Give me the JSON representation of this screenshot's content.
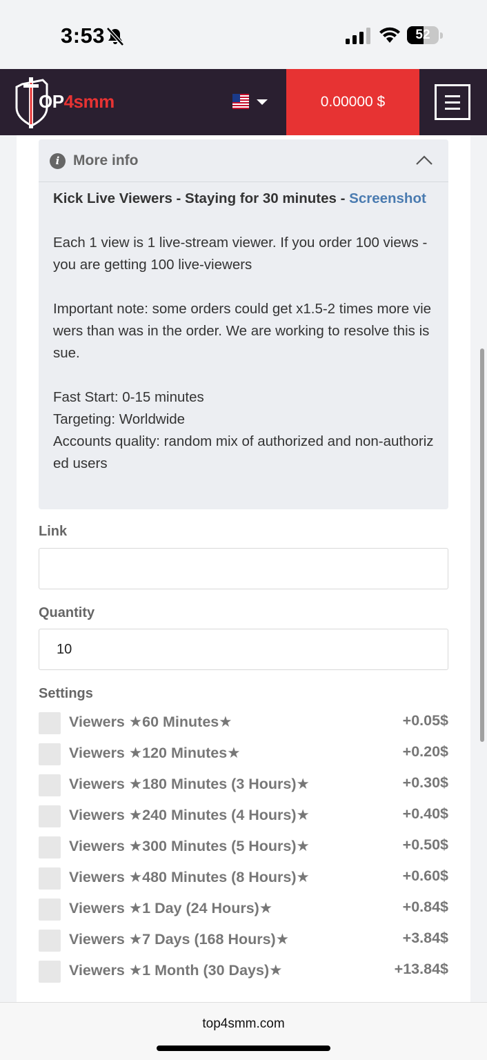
{
  "status_bar": {
    "time": "3:53",
    "battery_level": "52",
    "icons": [
      "bell-muted-icon",
      "cellular-signal-icon",
      "wifi-icon",
      "battery-icon"
    ]
  },
  "header": {
    "logo_prefix": "OP",
    "logo_accent": "4smm",
    "language_flag": "us-flag-icon",
    "balance": "0.00000 $",
    "menu_icon": "hamburger-menu-icon",
    "colors": {
      "background": "#2a1f30",
      "balance_bg": "#e73333"
    }
  },
  "more_info": {
    "title": "More info",
    "service_name": "Kick Live Viewers - Staying for 30 minutes - ",
    "screenshot_link": "Screenshot",
    "paragraph_1": "Each 1 view is 1 live-stream viewer. If you order 100 views - you are getting 100 live-viewers",
    "paragraph_2": "Important note: some orders could get x1.5-2 times more viewers than was in the order. We are working to resolve this issue.",
    "fast_start": "Fast Start: 0-15 minutes",
    "targeting": "Targeting: Worldwide",
    "accounts_quality": "Accounts quality: random mix of authorized and non-authorized users"
  },
  "form": {
    "link_label": "Link",
    "link_value": "",
    "quantity_label": "Quantity",
    "quantity_value": "10",
    "settings_label": "Settings"
  },
  "settings": [
    {
      "label": "Viewers ★60 Minutes★",
      "price": "+0.05$"
    },
    {
      "label": "Viewers ★120 Minutes★",
      "price": "+0.20$"
    },
    {
      "label": "Viewers ★180 Minutes (3 Hours)★",
      "price": "+0.30$"
    },
    {
      "label": "Viewers ★240 Minutes (4 Hours)★",
      "price": "+0.40$"
    },
    {
      "label": "Viewers ★300 Minutes (5 Hours)★",
      "price": "+0.50$"
    },
    {
      "label": "Viewers ★480 Minutes (8 Hours)★",
      "price": "+0.60$"
    },
    {
      "label": "Viewers ★1 Day (24 Hours)★",
      "price": "+0.84$"
    },
    {
      "label": "Viewers ★7 Days (168 Hours)★",
      "price": "+3.84$"
    },
    {
      "label": "Viewers ★1 Month (30 Days)★",
      "price": "+13.84$"
    }
  ],
  "browser": {
    "url": "top4smm.com"
  }
}
